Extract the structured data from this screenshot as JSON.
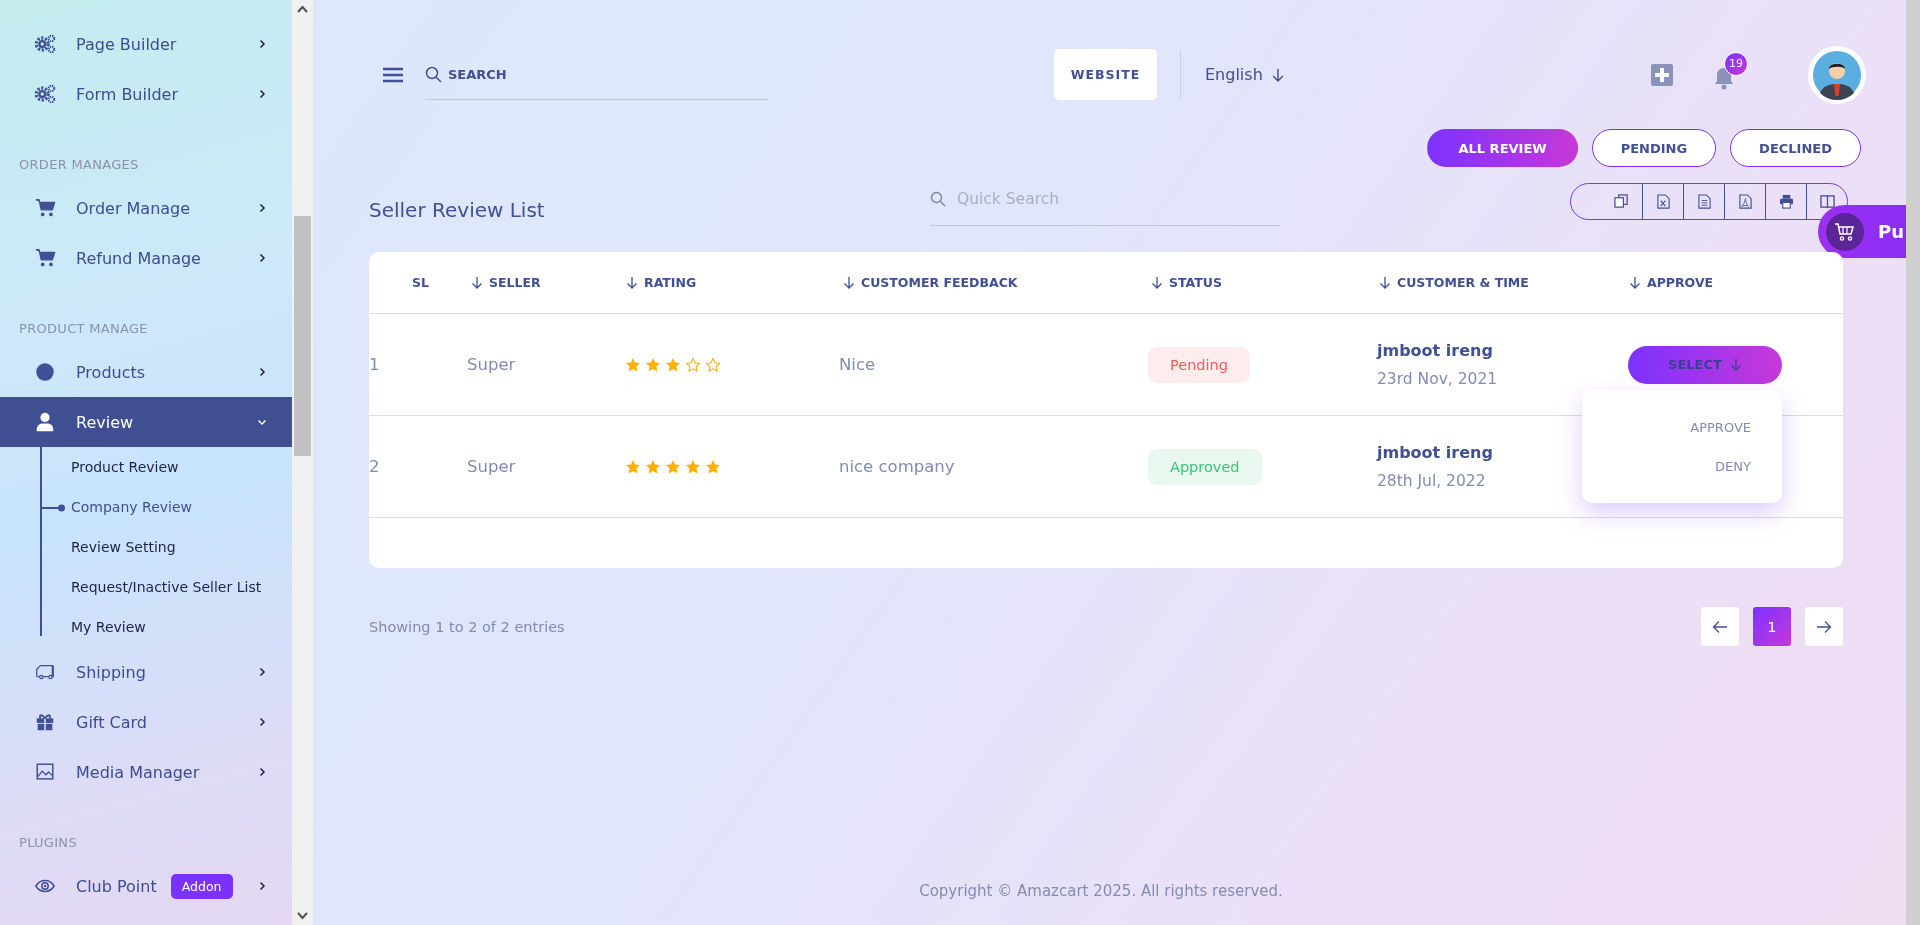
{
  "sidebar": {
    "sections": [
      {
        "items": [
          {
            "label": "Page Builder",
            "selected": false,
            "expanded": false
          },
          {
            "label": "Form Builder",
            "selected": false,
            "expanded": false
          }
        ]
      },
      {
        "heading": "ORDER MANAGES",
        "items": [
          {
            "label": "Order Manage",
            "selected": false,
            "expanded": false
          },
          {
            "label": "Refund Manage",
            "selected": false,
            "expanded": false
          }
        ]
      },
      {
        "heading": "PRODUCT MANAGE",
        "items": [
          {
            "label": "Products",
            "selected": false,
            "expanded": false
          },
          {
            "label": "Review",
            "selected": true,
            "expanded": true,
            "children": [
              {
                "label": "Product Review",
                "selected": false
              },
              {
                "label": "Company Review",
                "selected": true
              },
              {
                "label": "Review Setting",
                "selected": false
              },
              {
                "label": "Request/Inactive Seller List",
                "selected": false
              },
              {
                "label": "My Review",
                "selected": false
              }
            ]
          },
          {
            "label": "Shipping",
            "selected": false,
            "expanded": false
          },
          {
            "label": "Gift Card",
            "selected": false,
            "expanded": false
          },
          {
            "label": "Media Manager",
            "selected": false,
            "expanded": false
          }
        ]
      },
      {
        "heading": "PLUGINS",
        "items": [
          {
            "label": "Club Point",
            "selected": false,
            "expanded": false,
            "badge": "Addon"
          }
        ]
      }
    ]
  },
  "topbar": {
    "search": {
      "placeholder": "SEARCH"
    },
    "website_button": "WEBSITE",
    "language": "English",
    "notifications": {
      "count": "19"
    }
  },
  "filters": [
    {
      "label": "ALL REVIEW",
      "selected": true
    },
    {
      "label": "PENDING",
      "selected": false
    },
    {
      "label": "DECLINED",
      "selected": false
    }
  ],
  "title": "Seller Review List",
  "quick_search": {
    "placeholder": "Quick Search"
  },
  "purchase_button": {
    "label": "Pu"
  },
  "table": {
    "columns": [
      {
        "label": "SL",
        "sortable": false
      },
      {
        "label": "SELLER",
        "sortable": true
      },
      {
        "label": "RATING",
        "sortable": true
      },
      {
        "label": "CUSTOMER FEEDBACK",
        "sortable": true
      },
      {
        "label": "STATUS",
        "sortable": true
      },
      {
        "label": "CUSTOMER & TIME",
        "sortable": true
      },
      {
        "label": "APPROVE",
        "sortable": true
      }
    ],
    "rows": [
      {
        "sl": "1",
        "seller": "Super",
        "stars": 3,
        "feedback": "Nice",
        "status": {
          "label": "Pending",
          "kind": "pending"
        },
        "customer": "jmboot ireng",
        "time": "23rd Nov, 2021",
        "approve": {
          "label": "SELECT",
          "menu": {
            "open": true,
            "items": [
              "APPROVE",
              "DENY"
            ]
          }
        }
      },
      {
        "sl": "2",
        "seller": "Super",
        "stars": 5,
        "feedback": "nice company",
        "status": {
          "label": "Approved",
          "kind": "approved"
        },
        "customer": "jmboot ireng",
        "time": "28th Jul, 2022"
      }
    ]
  },
  "footer": {
    "info": "Showing 1 to 2 of 2 entries",
    "pages": [
      {
        "label": "1",
        "selected": true
      }
    ]
  },
  "copyright": "Copyright © Amazcart 2025. All rights reserved."
}
